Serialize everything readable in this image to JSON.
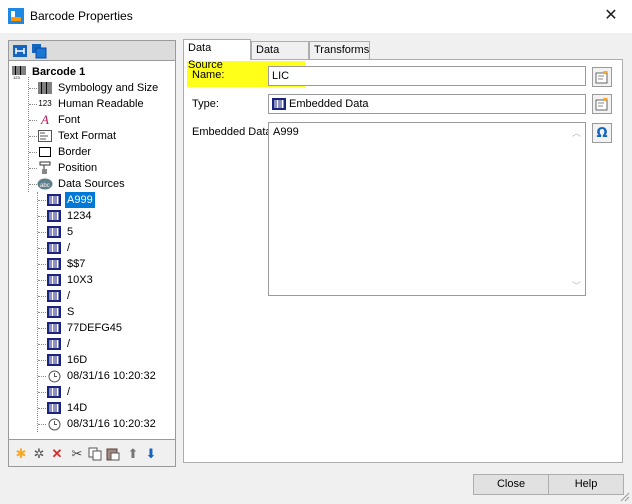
{
  "window": {
    "title": "Barcode Properties",
    "close_glyph": "✕"
  },
  "tree": {
    "root": {
      "label": "Barcode 1",
      "icon": "barcode-icon"
    },
    "children": [
      {
        "label": "Symbology and Size",
        "icon": "barcode-bars-icon"
      },
      {
        "label": "Human Readable",
        "icon": "numbers-123-icon",
        "icon_text": "123"
      },
      {
        "label": "Font",
        "icon": "font-icon",
        "icon_text": "A"
      },
      {
        "label": "Text Format",
        "icon": "text-format-icon"
      },
      {
        "label": "Border",
        "icon": "border-icon"
      },
      {
        "label": "Position",
        "icon": "position-icon"
      },
      {
        "label": "Data Sources",
        "icon": "data-sources-icon",
        "icon_text": "abc"
      }
    ],
    "data_sources": [
      {
        "label": "A999",
        "icon": "embedded-data-icon",
        "selected": true
      },
      {
        "label": "1234",
        "icon": "embedded-data-icon"
      },
      {
        "label": "5",
        "icon": "embedded-data-icon"
      },
      {
        "label": "/",
        "icon": "embedded-data-icon"
      },
      {
        "label": "$$7",
        "icon": "embedded-data-icon"
      },
      {
        "label": "10X3",
        "icon": "embedded-data-icon"
      },
      {
        "label": "/",
        "icon": "embedded-data-icon"
      },
      {
        "label": "S",
        "icon": "embedded-data-icon"
      },
      {
        "label": "77DEFG45",
        "icon": "embedded-data-icon"
      },
      {
        "label": "/",
        "icon": "embedded-data-icon"
      },
      {
        "label": "16D",
        "icon": "embedded-data-icon"
      },
      {
        "label": "08/31/16 10:20:32",
        "icon": "clock-icon"
      },
      {
        "label": "/",
        "icon": "embedded-data-icon"
      },
      {
        "label": "14D",
        "icon": "embedded-data-icon"
      },
      {
        "label": "08/31/16 10:20:32",
        "icon": "clock-icon"
      }
    ]
  },
  "tabs": [
    {
      "label": "Data Source",
      "active": true
    },
    {
      "label": "Data Type",
      "active": false
    },
    {
      "label": "Transforms",
      "active": false
    }
  ],
  "form": {
    "name_label": "Name:",
    "name_value": "LIC",
    "type_label": "Type:",
    "type_value": "Embedded Data",
    "embedded_label": "Embedded Data:",
    "embedded_value": "A999",
    "omega_glyph": "Ω"
  },
  "buttons": {
    "close": "Close",
    "help": "Help"
  },
  "colors": {
    "highlight": "#ffff1a",
    "selection": "#0078d7"
  }
}
